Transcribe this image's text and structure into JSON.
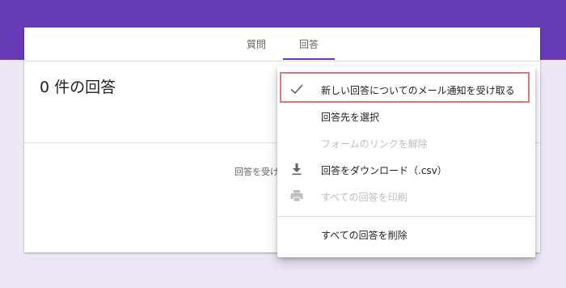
{
  "header": {
    "tabs": [
      {
        "label": "質問",
        "active": false
      },
      {
        "label": "回答",
        "active": true
      }
    ]
  },
  "main": {
    "title": "0 件の回答",
    "status_text": "回答を受け付けていません"
  },
  "menu": {
    "items": [
      {
        "label": "新しい回答についてのメール通知を受け取る",
        "icon": "checkmark-icon",
        "checked": true,
        "disabled": false
      },
      {
        "label": "回答先を選択",
        "icon": "",
        "disabled": false
      },
      {
        "label": "フォームのリンクを解除",
        "icon": "",
        "disabled": true
      },
      {
        "label": "回答をダウンロード（.csv）",
        "icon": "download-icon",
        "disabled": false
      },
      {
        "label": "すべての回答を印刷",
        "icon": "print-icon",
        "disabled": true
      },
      {
        "label": "すべての回答を削除",
        "icon": "",
        "disabled": false
      }
    ]
  },
  "colors": {
    "brand_purple": "#673ab7",
    "background": "#ede7f6",
    "highlight": "#d9797c",
    "disabled_text": "#bdbdbd"
  }
}
